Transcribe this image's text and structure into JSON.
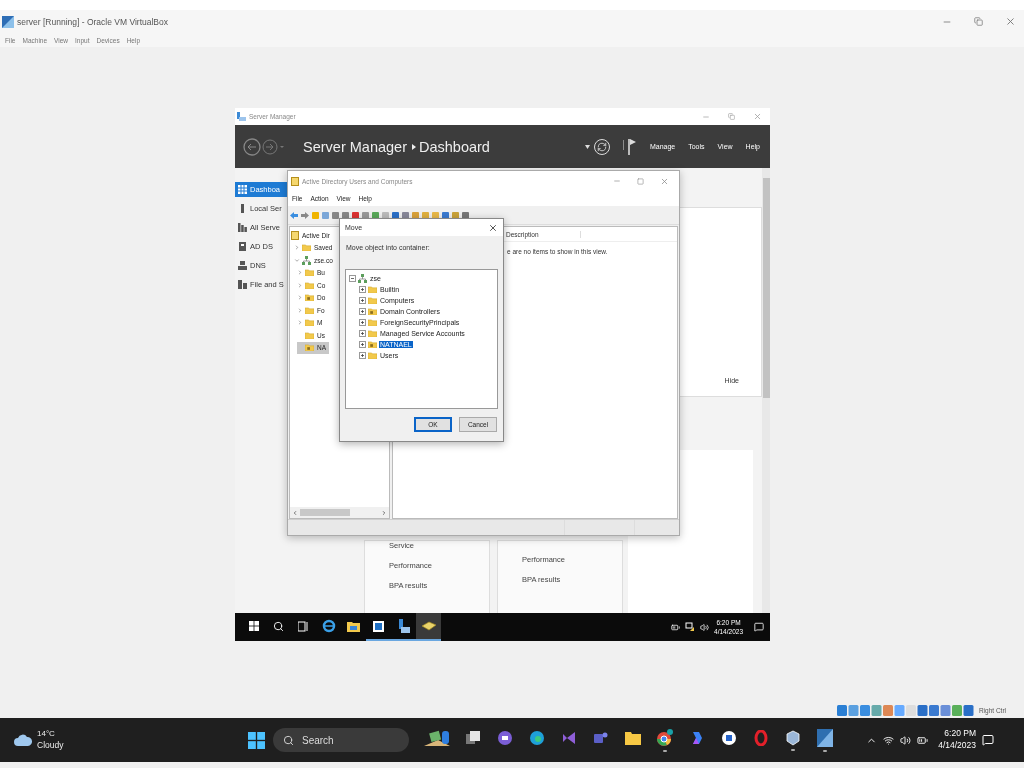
{
  "host_window": {
    "title": "server [Running] - Oracle VM VirtualBox",
    "menu": [
      "File",
      "Machine",
      "View",
      "Input",
      "Devices",
      "Help"
    ],
    "host_key": "Right Ctrl"
  },
  "server_manager": {
    "title": "Server Manager",
    "breadcrumb": [
      "Server Manager",
      "Dashboard"
    ],
    "header_menu": [
      "Manage",
      "Tools",
      "View",
      "Help"
    ],
    "sidebar": [
      {
        "label": "Dashboa",
        "kind": "dashboard",
        "selected": true
      },
      {
        "label": "Local Ser",
        "kind": "server",
        "selected": false
      },
      {
        "label": "All Serve",
        "kind": "servers",
        "selected": false
      },
      {
        "label": "AD DS",
        "kind": "adds",
        "selected": false
      },
      {
        "label": "DNS",
        "kind": "dns",
        "selected": false
      },
      {
        "label": "File and S",
        "kind": "files",
        "selected": false
      }
    ],
    "hide_link": "Hide",
    "tiles": [
      {
        "items": [
          "Service",
          "Performance",
          "BPA results"
        ]
      },
      {
        "items": [
          "Performance",
          "BPA results"
        ]
      }
    ]
  },
  "aduc": {
    "title": "Active Directory Users and Computers",
    "menu": [
      "File",
      "Action",
      "View",
      "Help"
    ],
    "tree": [
      {
        "label": "Active Dir",
        "kind": "root",
        "selected": false,
        "children": [
          {
            "label": "Saved",
            "kind": "folder",
            "expanded": false,
            "selected": false
          },
          {
            "label": "zse.co",
            "kind": "domain",
            "expanded": true,
            "selected": false,
            "children": [
              {
                "label": "Bu",
                "kind": "folder",
                "expanded": false,
                "selected": false
              },
              {
                "label": "Co",
                "kind": "folder",
                "expanded": false,
                "selected": false
              },
              {
                "label": "Do",
                "kind": "ou",
                "expanded": false,
                "selected": false
              },
              {
                "label": "Fo",
                "kind": "folder",
                "expanded": false,
                "selected": false
              },
              {
                "label": "M",
                "kind": "folder",
                "expanded": false,
                "selected": false
              },
              {
                "label": "Us",
                "kind": "folder",
                "selected": false
              },
              {
                "label": "NA",
                "kind": "ou",
                "selected": true
              }
            ]
          }
        ]
      }
    ],
    "columns": [
      "Description"
    ],
    "empty_message": "e are no items to show in this view."
  },
  "move_dialog": {
    "title": "Move",
    "prompt": "Move object into container:",
    "tree": {
      "label": "zse",
      "kind": "domain",
      "expanded": true,
      "children": [
        {
          "label": "Builtin",
          "kind": "folder",
          "expanded": false,
          "selected": false
        },
        {
          "label": "Computers",
          "kind": "folder",
          "expanded": false,
          "selected": false
        },
        {
          "label": "Domain Controllers",
          "kind": "ou",
          "expanded": false,
          "selected": false
        },
        {
          "label": "ForeignSecurityPrincipals",
          "kind": "folder",
          "expanded": false,
          "selected": false
        },
        {
          "label": "Managed Service Accounts",
          "kind": "folder",
          "expanded": false,
          "selected": false
        },
        {
          "label": "NATNAEL",
          "kind": "ou",
          "expanded": false,
          "selected": true
        },
        {
          "label": "Users",
          "kind": "folder",
          "expanded": false,
          "selected": false
        }
      ]
    },
    "buttons": [
      {
        "label": "OK",
        "default": true
      },
      {
        "label": "Cancel",
        "default": false
      }
    ]
  },
  "guest_taskbar": {
    "time": "6:20 PM",
    "date": "4/14/2023",
    "apps": [
      {
        "kind": "ie",
        "running": false,
        "active": false
      },
      {
        "kind": "explorer",
        "running": false,
        "active": false
      },
      {
        "kind": "window",
        "running": true,
        "active": false
      },
      {
        "kind": "server",
        "running": true,
        "active": false
      },
      {
        "kind": "aduc",
        "running": true,
        "active": true
      }
    ]
  },
  "host_taskbar": {
    "weather": {
      "temperature": "14°C",
      "condition": "Cloudy"
    },
    "search": {
      "placeholder": "Search"
    },
    "time": "6:20 PM",
    "date": "4/14/2023",
    "apps": [
      {
        "kind": "widgets",
        "running": false
      },
      {
        "kind": "taskview",
        "running": false
      },
      {
        "kind": "meet",
        "running": false
      },
      {
        "kind": "edge",
        "running": false
      },
      {
        "kind": "studio",
        "running": false
      },
      {
        "kind": "teams",
        "running": false
      },
      {
        "kind": "explorer",
        "running": false
      },
      {
        "kind": "chrome",
        "running": true
      },
      {
        "kind": "copilot",
        "running": false
      },
      {
        "kind": "mail",
        "running": false
      },
      {
        "kind": "opera",
        "running": false
      },
      {
        "kind": "virtualbox",
        "running": true
      },
      {
        "kind": "vm",
        "running": true
      }
    ]
  }
}
